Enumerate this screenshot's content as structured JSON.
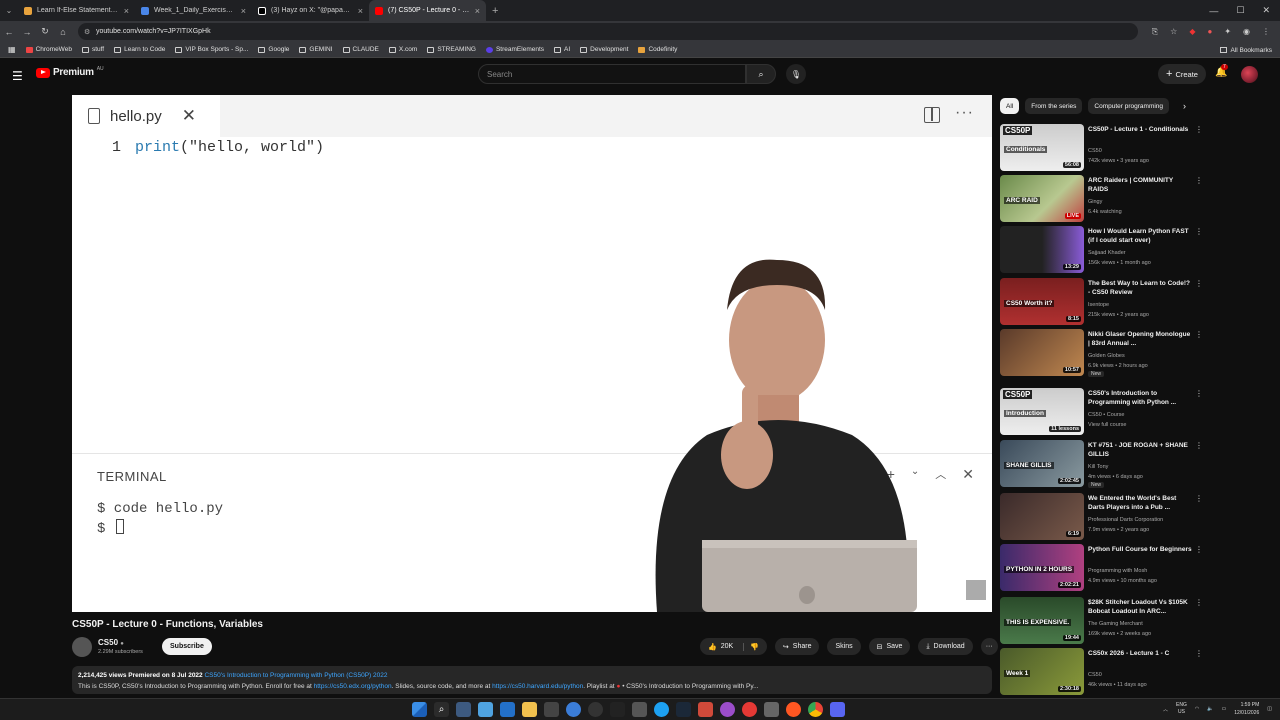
{
  "browser": {
    "tabs": [
      {
        "title": "Learn If-Else Statements Practic",
        "color": "#e8a33d",
        "active": false
      },
      {
        "title": "Week_1_Daily_Exercise_Guide.ur",
        "color": "#4a86e8",
        "active": false
      },
      {
        "title": "(3) Hayz on X: \"@papakowkow",
        "color": "#ffffff",
        "active": false
      },
      {
        "title": "(7) CS50P - Lecture 0 - Functio",
        "color": "#ff0000",
        "active": true
      }
    ],
    "new_tab": "+",
    "url": "youtube.com/watch?v=JP7ITIXGpHk",
    "bookmarks": [
      "ChromeWeb",
      "stuff",
      "Learn to Code",
      "VIP Box Sports - Sp...",
      "Google",
      "GEMINI",
      "CLAUDE",
      "X.com",
      "STREAMING",
      "StreamElements",
      "AI",
      "Development",
      "Codefinity"
    ],
    "all_bookmarks": "All Bookmarks"
  },
  "youtube": {
    "logo_text": "Premium",
    "country": "AU",
    "search_placeholder": "Search",
    "create_label": "Create",
    "notif_count": "7"
  },
  "video": {
    "editor_filename": "hello.py",
    "code_line_number": "1",
    "code_fn": "print",
    "code_args": "(\"hello, world\")",
    "terminal_title": "TERMINAL",
    "terminal_line1": "$ code hello.py",
    "terminal_prompt": "$",
    "title": "CS50P - Lecture 0 - Functions, Variables",
    "channel": "CS50",
    "subscribers": "2.29M subscribers",
    "subscribe_label": "Subscribe",
    "likes": "20K",
    "share": "Share",
    "skins": "Skins",
    "save": "Save",
    "download": "Download",
    "desc_stats": "2,214,425 views  Premiered on 8 Jul 2022",
    "desc_link1": "CS50's Introduction to Programming with Python (CS50P) 2022",
    "desc_line2a": "This is CS50P, CS50's Introduction to Programming with Python. Enroll for free at",
    "desc_link2": "https://cs50.edx.org/python",
    "desc_line2b": ". Slides, source code, and more at",
    "desc_link3": "https://cs50.harvard.edu/python",
    "desc_line2c": ". Playlist at",
    "desc_line2d": "• CS50's Introduction to Programming with Py..."
  },
  "chips": [
    "All",
    "From the series",
    "Computer programming"
  ],
  "recommendations": [
    {
      "title": "CS50P - Lecture 1 - Conditionals",
      "channel": "CS50",
      "meta": "742k views • 3 years ago",
      "duration": "56:08",
      "badge": "",
      "thumb": "cond"
    },
    {
      "title": "ARC Raiders | COMMUNITY RAIDS",
      "channel": "Gingy",
      "meta": "6.4k watching",
      "duration": "LIVE",
      "badge": "",
      "thumb": "arc"
    },
    {
      "title": "How I Would Learn Python FAST (if I could start over)",
      "channel": "Sajjaad Khader",
      "meta": "156k views • 1 month ago",
      "duration": "13:29",
      "badge": "",
      "thumb": "learn"
    },
    {
      "title": "The Best Way to Learn to Code!? - CS50 Review",
      "channel": "Isentope",
      "meta": "215k views • 2 years ago",
      "duration": "8:15",
      "badge": "",
      "thumb": "worth"
    },
    {
      "title": "Nikki Glaser Opening Monologue | 83rd Annual ...",
      "channel": "Golden Globes",
      "meta": "6.9k views • 2 hours ago",
      "duration": "10:57",
      "badge": "New",
      "thumb": "globes"
    },
    {
      "title": "CS50's Introduction to Programming with Python ...",
      "channel": "CS50 • Course",
      "meta": "View full course",
      "duration": "11 lessons",
      "badge": "",
      "thumb": "intro"
    },
    {
      "title": "KT #751 - JOE ROGAN + SHANE GILLIS",
      "channel": "Kill Tony",
      "meta": "4m views • 6 days ago",
      "duration": "2:02:45",
      "badge": "New",
      "thumb": "kt"
    },
    {
      "title": "We Entered the World's Best Darts Players into a Pub ...",
      "channel": "Professional Darts Corporation",
      "meta": "7.9m views • 2 years ago",
      "duration": "6:19",
      "badge": "",
      "thumb": "darts"
    },
    {
      "title": "Python Full Course for Beginners",
      "channel": "Programming with Mosh",
      "meta": "4.9m views • 10 months ago",
      "duration": "2:02:21",
      "badge": "",
      "thumb": "mosh"
    },
    {
      "title": "$28K Stitcher Loadout Vs $105K Bobcat Loadout In ARC...",
      "channel": "The Gaming Merchant",
      "meta": "169k views • 2 weeks ago",
      "duration": "19:44",
      "badge": "",
      "thumb": "exp"
    },
    {
      "title": "CS50x 2026 - Lecture 1 - C",
      "channel": "CS50",
      "meta": "46k views • 11 days ago",
      "duration": "2:30:18",
      "badge": "",
      "thumb": "cs50x"
    }
  ],
  "thumb_text": {
    "cond_top": "CS50P",
    "cond_label": "Conditionals",
    "arc_label": "ARC RAID",
    "learn_label": "",
    "worth_label": "CS50 Worth it?",
    "intro_top": "CS50P",
    "intro_label": "Introduction",
    "kt_label": "SHANE GILLIS",
    "mosh_label": "PYTHON IN 2 HOURS",
    "exp_label": "THIS IS EXPENSIVE.",
    "cs50x_label": "Week 1"
  },
  "taskbar": {
    "lang": "ENG",
    "region": "US",
    "time": "1:59 PM",
    "date": "12/01/2026"
  },
  "colors": {
    "yt_red": "#ff0000",
    "link": "#3ea6ff",
    "code_fn": "#2a7ab0"
  }
}
